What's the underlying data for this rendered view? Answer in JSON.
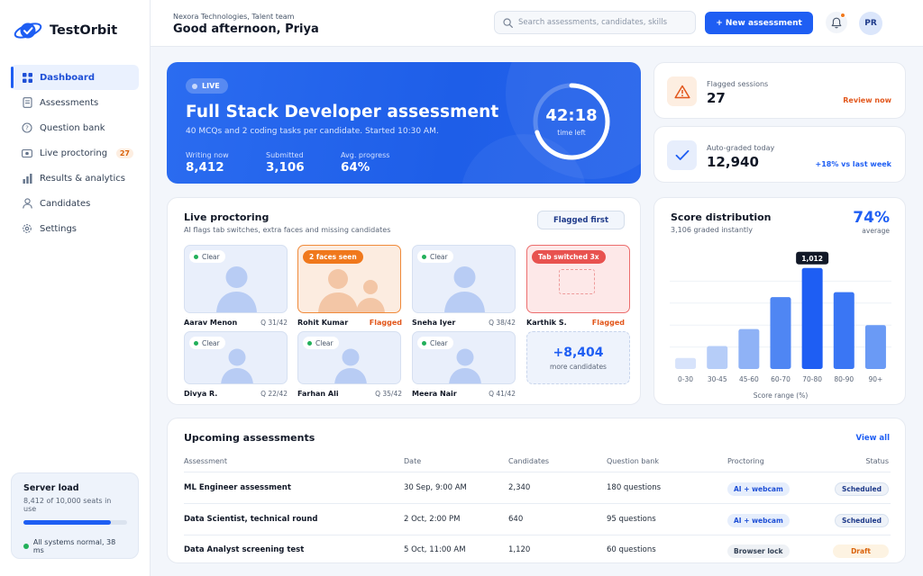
{
  "app": {
    "name": "TestOrbit"
  },
  "sidebar": {
    "items": [
      {
        "label": "Dashboard",
        "icon": "grid-icon",
        "active": true
      },
      {
        "label": "Assessments",
        "icon": "document-icon"
      },
      {
        "label": "Question bank",
        "icon": "question-icon"
      },
      {
        "label": "Live proctoring",
        "icon": "camera-icon",
        "badge": "27"
      },
      {
        "label": "Results & analytics",
        "icon": "bar-chart-icon"
      },
      {
        "label": "Candidates",
        "icon": "user-icon"
      },
      {
        "label": "Settings",
        "icon": "gear-icon"
      }
    ],
    "server": {
      "title": "Server load",
      "subtitle": "8,412 of 10,000 seats in use",
      "usage": 0.84,
      "status": "All systems normal, 38 ms"
    }
  },
  "header": {
    "org": "Nexora Technologies, Talent team",
    "greeting": "Good afternoon, Priya",
    "search_placeholder": "Search assessments, candidates, skills",
    "new_button": "+ New assessment",
    "avatar": "PR"
  },
  "hero": {
    "badge": "LIVE",
    "title": "Full Stack Developer assessment",
    "subtitle": "40 MCQs and 2 coding tasks per candidate. Started 10:30 AM.",
    "stats": [
      {
        "label": "Writing now",
        "value": "8,412"
      },
      {
        "label": "Submitted",
        "value": "3,106"
      },
      {
        "label": "Avg. progress",
        "value": "64%"
      }
    ],
    "timer": {
      "value": "42:18",
      "label": "time left",
      "progress": 0.7
    }
  },
  "kpis": {
    "flagged": {
      "label": "Flagged sessions",
      "value": "27",
      "link": "Review now"
    },
    "graded": {
      "label": "Auto-graded today",
      "value": "12,940",
      "delta": "+18% vs last week"
    }
  },
  "proctoring": {
    "title": "Live proctoring",
    "subtitle": "AI flags tab switches, extra faces and missing candidates",
    "filter": "Flagged first",
    "tiles": [
      {
        "name": "Aarav Menon",
        "progress": "Q 31/42",
        "pill": "Clear",
        "state": "clear"
      },
      {
        "name": "Rohit Kumar",
        "progress": "Flagged",
        "pill": "2 faces seen",
        "state": "faces"
      },
      {
        "name": "Sneha Iyer",
        "progress": "Q 38/42",
        "pill": "Clear",
        "state": "clear"
      },
      {
        "name": "Karthik S.",
        "progress": "Flagged",
        "pill": "Tab switched 3x",
        "state": "tab"
      },
      {
        "name": "Divya R.",
        "progress": "Q 22/42",
        "pill": "Clear",
        "state": "clear"
      },
      {
        "name": "Farhan Ali",
        "progress": "Q 35/42",
        "pill": "Clear",
        "state": "clear"
      },
      {
        "name": "Meera Nair",
        "progress": "Q 41/42",
        "pill": "Clear",
        "state": "clear"
      }
    ],
    "more": {
      "count": "+8,404",
      "label": "more candidates"
    }
  },
  "distribution": {
    "title": "Score distribution",
    "subtitle": "3,106 graded instantly",
    "average": "74%",
    "average_label": "average"
  },
  "chart_data": {
    "type": "bar",
    "title": "Score distribution",
    "xlabel": "Score range (%)",
    "ylabel": "",
    "categories": [
      "0-30",
      "30-45",
      "45-60",
      "60-70",
      "70-80",
      "80-90",
      "90+"
    ],
    "values": [
      110,
      230,
      400,
      720,
      1012,
      770,
      440
    ],
    "ylim": [
      0,
      1100
    ],
    "highlight": {
      "category": "70-80",
      "label": "1,012"
    },
    "colors": [
      "#d7e3fb",
      "#b6cdf8",
      "#8fb2f6",
      "#4f86f3",
      "#1e5ef3",
      "#3a76f4",
      "#6a9af5"
    ]
  },
  "upcoming": {
    "title": "Upcoming assessments",
    "view_all": "View all",
    "columns": [
      "Assessment",
      "Date",
      "Candidates",
      "Question bank",
      "Proctoring",
      "Status"
    ],
    "rows": [
      {
        "name": "ML Engineer assessment",
        "date": "30 Sep, 9:00 AM",
        "candidates": "2,340",
        "bank": "180 questions",
        "proctoring": "AI + webcam",
        "status": "Scheduled"
      },
      {
        "name": "Data Scientist, technical round",
        "date": "2 Oct, 2:00 PM",
        "candidates": "640",
        "bank": "95 questions",
        "proctoring": "AI + webcam",
        "status": "Scheduled"
      },
      {
        "name": "Data Analyst screening test",
        "date": "5 Oct, 11:00 AM",
        "candidates": "1,120",
        "bank": "60 questions",
        "proctoring": "Browser lock",
        "status": "Draft"
      }
    ]
  },
  "colors": {
    "accent": "#1e5ef3",
    "warn": "#f0781c",
    "danger": "#ec6d6d",
    "success": "#22b05a"
  }
}
